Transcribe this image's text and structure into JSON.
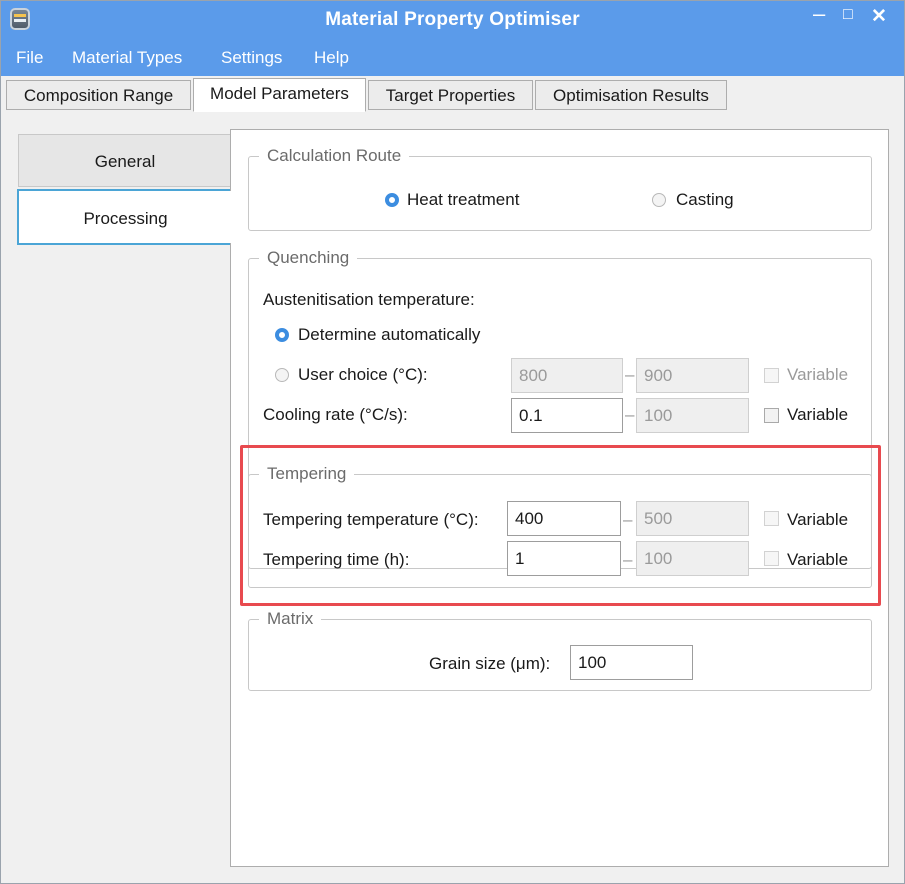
{
  "window": {
    "title": "Material Property Optimiser",
    "icon": "app-icon",
    "controls": {
      "minimize": "–",
      "maximize": "□",
      "close": "✕"
    }
  },
  "menu": {
    "items": [
      "File",
      "Material Types",
      "Settings",
      "Help"
    ]
  },
  "tabs": [
    {
      "label": "Composition Range",
      "active": false
    },
    {
      "label": "Model Parameters",
      "active": true
    },
    {
      "label": "Target Properties",
      "active": false
    },
    {
      "label": "Optimisation Results",
      "active": false
    }
  ],
  "sidebar": {
    "items": [
      {
        "label": "General",
        "active": false
      },
      {
        "label": "Processing",
        "active": true
      }
    ]
  },
  "calculation_route": {
    "title": "Calculation Route",
    "options": [
      {
        "label": "Heat treatment",
        "selected": true
      },
      {
        "label": "Casting",
        "selected": false
      }
    ]
  },
  "quenching": {
    "title": "Quenching",
    "austenitisation_label": "Austenitisation temperature:",
    "auto_label": "Determine automatically",
    "auto_selected": true,
    "user_choice": {
      "label": "User choice (°C):",
      "min": "800",
      "max": "900",
      "variable_label": "Variable",
      "enabled": false
    },
    "cooling_rate": {
      "label": "Cooling rate (°C/s):",
      "min": "0.1",
      "max": "100",
      "variable_label": "Variable"
    }
  },
  "tempering": {
    "title": "Tempering",
    "temperature": {
      "label": "Tempering temperature (°C):",
      "min": "400",
      "max": "500",
      "variable_label": "Variable"
    },
    "time": {
      "label": "Tempering time (h):",
      "min": "1",
      "max": "100",
      "variable_label": "Variable"
    }
  },
  "matrix": {
    "title": "Matrix",
    "grain_size": {
      "label": "Grain size (μm):",
      "value": "100"
    }
  },
  "colors": {
    "titlebar": "#5b9bea",
    "accent": "#3c8de0",
    "highlight": "#e84a4f",
    "sidebar_active_border": "#4ba5d6"
  }
}
